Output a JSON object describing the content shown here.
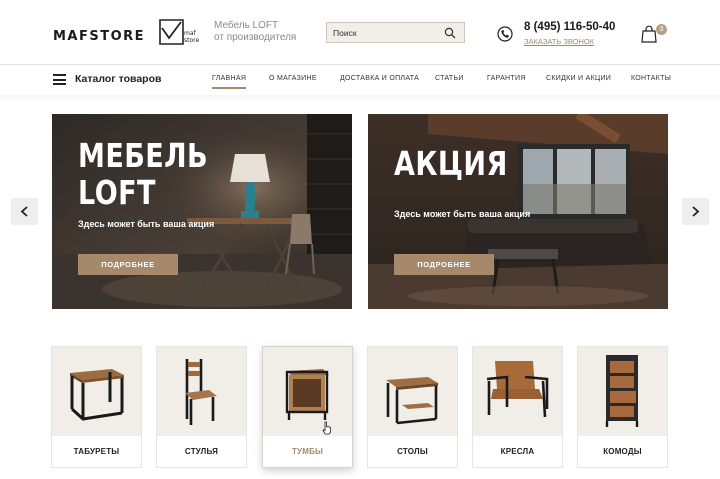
{
  "header": {
    "logo_text": "MAFSTORE",
    "logo_mark_line1": "maf",
    "logo_mark_line2": "store",
    "tagline_line1": "Мебель LOFT",
    "tagline_line2": "от производителя",
    "search_placeholder": "Поиск",
    "phone": "8 (495) 116-50-40",
    "callback_label": "ЗАКАЗАТЬ ЗВОНОК",
    "cart_count": "3"
  },
  "nav": {
    "catalog_label": "Каталог товаров",
    "items": [
      {
        "label": "ГЛАВНАЯ",
        "active": true
      },
      {
        "label": "О МАГАЗИНЕ"
      },
      {
        "label": "ДОСТАВКА И ОПЛАТА"
      },
      {
        "label": "СТАТЬИ"
      },
      {
        "label": "ГАРАНТИЯ"
      },
      {
        "label": "СКИДКИ И АКЦИИ"
      },
      {
        "label": "КОНТАКТЫ"
      }
    ]
  },
  "banners": [
    {
      "title_line1": "МЕБЕЛЬ",
      "title_line2": "LOFT",
      "subtitle": "Здесь может быть ваша акция",
      "button": "ПОДРОБНЕЕ"
    },
    {
      "title_line1": "АКЦИЯ",
      "subtitle": "Здесь может быть ваша акция",
      "button": "ПОДРОБНЕЕ"
    }
  ],
  "categories": [
    {
      "label": "ТАБУРЕТЫ"
    },
    {
      "label": "СТУЛЬЯ"
    },
    {
      "label": "ТУМБЫ",
      "active": true
    },
    {
      "label": "СТОЛЫ"
    },
    {
      "label": "КРЕСЛА"
    },
    {
      "label": "КОМОДЫ"
    }
  ],
  "colors": {
    "accent": "#a5896a",
    "badge": "#b79f82",
    "search_bg": "#f2eee8",
    "tile_bg": "#f1eee8"
  },
  "icons": {
    "search": "search-icon",
    "phone": "phone-icon",
    "cart": "cart-icon",
    "menu": "menu-icon",
    "prev": "chevron-left-icon",
    "next": "chevron-right-icon"
  }
}
